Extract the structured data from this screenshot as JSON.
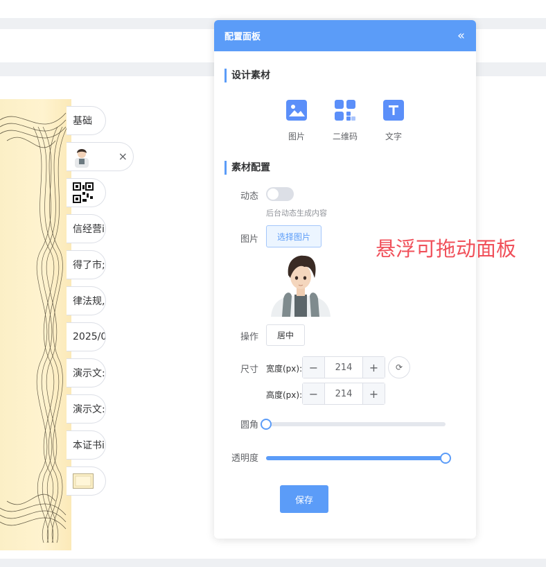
{
  "panel": {
    "title": "配置面板",
    "collapse_icon": "double-chevron-left-icon",
    "section_design": "设计素材",
    "materials": [
      {
        "label": "图片",
        "icon": "image-icon"
      },
      {
        "label": "二维码",
        "icon": "qrcode-icon"
      },
      {
        "label": "文字",
        "icon": "text-icon"
      }
    ],
    "section_config": "素材配置",
    "dynamic_label": "动态",
    "dynamic_on": false,
    "dynamic_hint": "后台动态生成内容",
    "image_label": "图片",
    "select_image": "选择图片",
    "operation_label": "操作",
    "center_button": "居中",
    "size_label": "尺寸",
    "width_label": "宽度(px):",
    "width_value": "214",
    "height_label": "高度(px):",
    "height_value": "214",
    "radius_label": "圆角",
    "radius_value": 0,
    "opacity_label": "透明度",
    "opacity_value": 100,
    "save_button": "保存",
    "accent": "#5b9cf8"
  },
  "layers": [
    {
      "label": "基础"
    },
    {
      "label": "",
      "type": "avatar"
    },
    {
      "label": "",
      "type": "qrcode"
    },
    {
      "label": "信经营i"
    },
    {
      "label": "得了市;"
    },
    {
      "label": "律法规,"
    },
    {
      "label": "2025/0"
    },
    {
      "label": "演示文:"
    },
    {
      "label": "演示文:"
    },
    {
      "label": "本证书i"
    },
    {
      "label": "",
      "type": "image"
    }
  ],
  "annotation": "悬浮可拖动面板"
}
